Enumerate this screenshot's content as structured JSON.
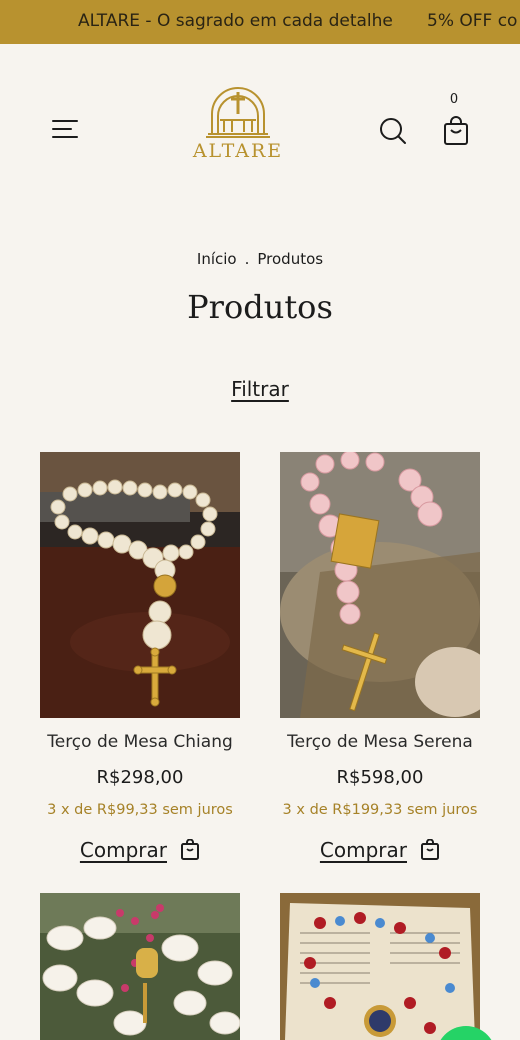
{
  "announcement": {
    "text1": "ALTARE - O sagrado em cada detalhe",
    "text2": "5% OFF co"
  },
  "header": {
    "logo_text": "ALTARE",
    "cart_count": "0",
    "icons": [
      "menu-icon",
      "search-icon",
      "cart-icon"
    ]
  },
  "breadcrumb": {
    "home": "Início",
    "separator": ".",
    "current": "Produtos"
  },
  "page": {
    "title": "Produtos",
    "filter_label": "Filtrar"
  },
  "products": [
    {
      "name": "Terço de Mesa Chiang",
      "price": "R$298,00",
      "installments": "3 x de R$99,33 sem juros",
      "buy_label": "Comprar"
    },
    {
      "name": "Terço de Mesa Serena",
      "price": "R$598,00",
      "installments": "3 x de R$199,33 sem juros",
      "buy_label": "Comprar"
    }
  ],
  "colors": {
    "accent": "#b8922f",
    "background": "#f7f4ef",
    "installment_text": "#a68228",
    "whatsapp": "#25d366"
  }
}
